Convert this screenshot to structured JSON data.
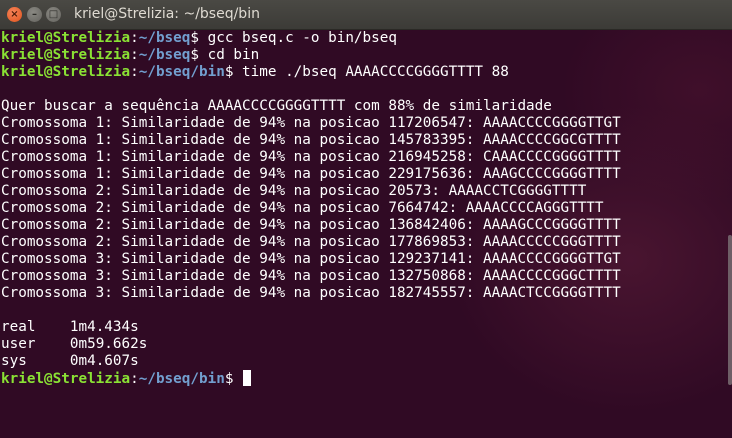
{
  "window": {
    "title": "kriel@Strelizia: ~/bseq/bin"
  },
  "prompts": [
    {
      "user": "kriel@Strelizia",
      "sep": ":",
      "path": "~/bseq",
      "dollar": "$ ",
      "cmd": "gcc bseq.c -o bin/bseq"
    },
    {
      "user": "kriel@Strelizia",
      "sep": ":",
      "path": "~/bseq",
      "dollar": "$ ",
      "cmd": "cd bin"
    },
    {
      "user": "kriel@Strelizia",
      "sep": ":",
      "path": "~/bseq/bin",
      "dollar": "$ ",
      "cmd": "time ./bseq AAAACCCCGGGGTTTT 88"
    }
  ],
  "output": {
    "header": "Quer buscar a sequência AAAACCCCGGGGTTTT com 88% de similaridade",
    "results": [
      "Cromossoma 1: Similaridade de 94% na posicao 117206547: AAAACCCCGGGGTTGT",
      "Cromossoma 1: Similaridade de 94% na posicao 145783395: AAAACCCCGGCGTTTT",
      "Cromossoma 1: Similaridade de 94% na posicao 216945258: CAAACCCCGGGGTTTT",
      "Cromossoma 1: Similaridade de 94% na posicao 229175636: AAAGCCCCGGGGTTTT",
      "Cromossoma 2: Similaridade de 94% na posicao 20573: AAAACCTCGGGGTTTT",
      "Cromossoma 2: Similaridade de 94% na posicao 7664742: AAAACCCCAGGGTTTT",
      "Cromossoma 2: Similaridade de 94% na posicao 136842406: AAAAGCCCGGGGTTTT",
      "Cromossoma 2: Similaridade de 94% na posicao 177869853: AAAACCCCCGGGTTTT",
      "Cromossoma 3: Similaridade de 94% na posicao 129237141: AAAACCCCGGGGTTGT",
      "Cromossoma 3: Similaridade de 94% na posicao 132750868: AAAACCCCGGGCTTTT",
      "Cromossoma 3: Similaridade de 94% na posicao 182745557: AAAACTCCGGGGTTTT"
    ],
    "timing": [
      "real\t1m4.434s",
      "user\t0m59.662s",
      "sys\t0m4.607s"
    ]
  },
  "final_prompt": {
    "user": "kriel@Strelizia",
    "sep": ":",
    "path": "~/bseq/bin",
    "dollar": "$ "
  },
  "colors": {
    "background": "#300a24",
    "user": "#8ae234",
    "path": "#729fcf",
    "text": "#ffffff"
  }
}
